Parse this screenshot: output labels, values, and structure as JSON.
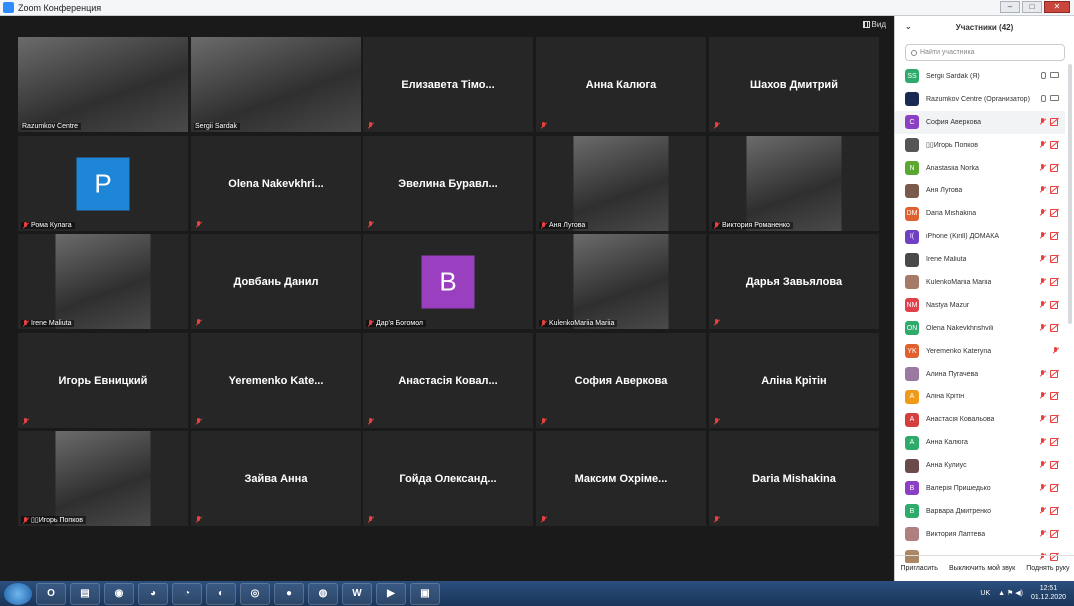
{
  "window": {
    "title": "Zoom Конференция"
  },
  "view_button": "Вид",
  "tiles": [
    {
      "kind": "video",
      "label": "Razumkov Centre",
      "muted": false,
      "active": true
    },
    {
      "kind": "video",
      "label": "Sergii Sardak",
      "muted": false
    },
    {
      "kind": "name",
      "name": "Елизавета Тімо...",
      "muted": true
    },
    {
      "kind": "name",
      "name": "Анна Калюга",
      "muted": true
    },
    {
      "kind": "name",
      "name": "Шахов Дмитрий",
      "muted": true
    },
    {
      "kind": "avatar",
      "letter": "P",
      "color": "#1d86d6",
      "label": "Рома Кулага",
      "muted": true
    },
    {
      "kind": "name",
      "name": "Olena  Nakevkhri...",
      "muted": true
    },
    {
      "kind": "name",
      "name": "Эвелина  Буравл...",
      "muted": true
    },
    {
      "kind": "video",
      "label": "Аня Лугова",
      "muted": true
    },
    {
      "kind": "video",
      "label": "Виктория Романенко",
      "muted": true
    },
    {
      "kind": "video",
      "label": "Irene Maliuta",
      "muted": true
    },
    {
      "kind": "name",
      "name": "Довбань Данил",
      "muted": true
    },
    {
      "kind": "avatar",
      "letter": "В",
      "color": "#9b3fc1",
      "label": "Дар'я Богомол",
      "muted": true
    },
    {
      "kind": "video",
      "label": "KulenkoMariia Mariia",
      "muted": true
    },
    {
      "kind": "name",
      "name": "Дарья Завьялова",
      "muted": true
    },
    {
      "kind": "name",
      "name": "Игорь Евницкий",
      "muted": true
    },
    {
      "kind": "name",
      "name": "Yeremenko  Kate...",
      "muted": true
    },
    {
      "kind": "name",
      "name": "Анастасія  Ковал...",
      "muted": true
    },
    {
      "kind": "name",
      "name": "София Аверкова",
      "muted": true
    },
    {
      "kind": "name",
      "name": "Аліна Крітін",
      "muted": true
    },
    {
      "kind": "video",
      "label": "▯▯Игорь Попков",
      "muted": true
    },
    {
      "kind": "name",
      "name": "Зайва Анна",
      "muted": true
    },
    {
      "kind": "name",
      "name": "Гойда  Олександ...",
      "muted": true
    },
    {
      "kind": "name",
      "name": "Максим  Охріме...",
      "muted": true
    },
    {
      "kind": "name",
      "name": "Daria Mishakina",
      "muted": true
    }
  ],
  "participants_panel": {
    "title": "Участники (42)",
    "search_placeholder": "Найти участника",
    "participants": [
      {
        "initials": "SS",
        "color": "#2eaa6b",
        "name": "Sergii Sardak (Я)",
        "state": "on"
      },
      {
        "initials": "",
        "color": "#1b2a55",
        "name": "Razumkov Centre (Организатор)",
        "state": "on"
      },
      {
        "initials": "С",
        "color": "#8a3fc4",
        "name": "София Аверкова",
        "state": "muted",
        "hl": true
      },
      {
        "initials": "",
        "color": "#555555",
        "name": "▯▯Игорь Попков",
        "state": "muted"
      },
      {
        "initials": "N",
        "color": "#5aa832",
        "name": "Anastasiia Norka",
        "state": "muted"
      },
      {
        "initials": "",
        "color": "#7a5a4a",
        "name": "Аня Лугова",
        "state": "muted"
      },
      {
        "initials": "DM",
        "color": "#e0612f",
        "name": "Daria Mishakina",
        "state": "muted"
      },
      {
        "initials": "I(",
        "color": "#6f3fc4",
        "name": "iPhone (Kirill) ДОМАКА",
        "state": "muted"
      },
      {
        "initials": "",
        "color": "#4a4a4a",
        "name": "Irene Maliuta",
        "state": "muted"
      },
      {
        "initials": "",
        "color": "#a57a66",
        "name": "KulenkoMariia Mariia",
        "state": "muted"
      },
      {
        "initials": "NM",
        "color": "#e0404a",
        "name": "Nastya Mazur",
        "state": "muted"
      },
      {
        "initials": "ON",
        "color": "#2eaa6b",
        "name": "Olena Nakevkhrishvili",
        "state": "muted"
      },
      {
        "initials": "YK",
        "color": "#e0612f",
        "name": "Yeremenko Kateryna",
        "state": "mic-muted"
      },
      {
        "initials": "",
        "color": "#9a7aa0",
        "name": "Алина Пугачева",
        "state": "muted"
      },
      {
        "initials": "А",
        "color": "#f09a1a",
        "name": "Аліна Крітін",
        "state": "muted"
      },
      {
        "initials": "А",
        "color": "#d33f3f",
        "name": "Анастасія Ковальова",
        "state": "muted"
      },
      {
        "initials": "А",
        "color": "#2eaa6b",
        "name": "Анна Калюга",
        "state": "muted"
      },
      {
        "initials": "",
        "color": "#6a4a4a",
        "name": "Анна Кулиус",
        "state": "muted"
      },
      {
        "initials": "В",
        "color": "#8a3fc4",
        "name": "Валерія Пришедько",
        "state": "muted"
      },
      {
        "initials": "В",
        "color": "#2eaa6b",
        "name": "Варвара Дмитренко",
        "state": "muted"
      },
      {
        "initials": "",
        "color": "#b08080",
        "name": "Виктория Лаптева",
        "state": "muted"
      },
      {
        "initials": "",
        "color": "#aa8866",
        "name": "",
        "state": "muted"
      }
    ],
    "footer": {
      "invite": "Пригласить",
      "mute_all": "Выключить мой звук",
      "raise_hand": "Поднять руку"
    }
  },
  "taskbar": {
    "apps": [
      "O",
      "▤",
      "◉",
      "◕",
      "◔",
      "◐",
      "◎",
      "●",
      "◍",
      "W",
      "▶",
      "▣"
    ],
    "lang": "UK",
    "time": "12:51",
    "date": "01.12.2020"
  }
}
